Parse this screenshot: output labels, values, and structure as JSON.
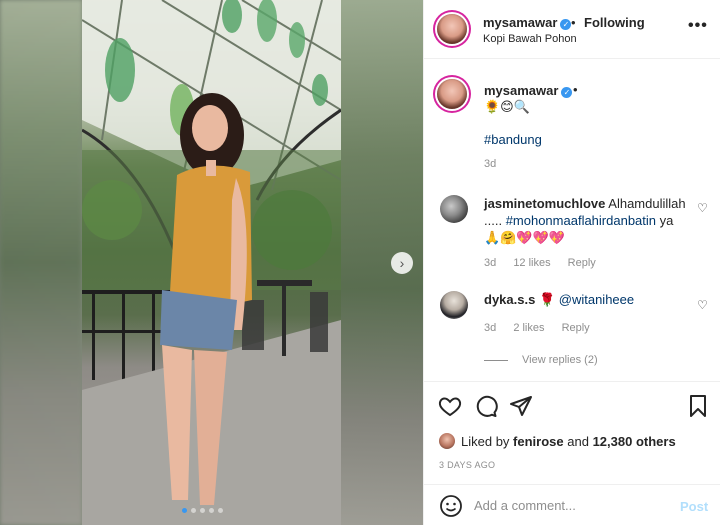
{
  "header": {
    "username": "mysamawar",
    "separator": "•",
    "follow_status": "Following",
    "location": "Kopi Bawah Pohon",
    "more_icon": "more-horizontal-icon",
    "more_label": "•••"
  },
  "caption": {
    "username": "mysamawar",
    "dot": "•",
    "emojis": "🌻😊🔍",
    "hashtag": "#bandung",
    "time": "3d"
  },
  "comments": [
    {
      "username": "jasminetomuchlove",
      "text_before": "Alhamdulillah .....",
      "tag": "#mohonmaaflahirdanbatin",
      "text_after": "ya",
      "emojis": "🙏🤗💖💖💖",
      "time": "3d",
      "likes": "12 likes",
      "reply": "Reply"
    },
    {
      "username": "dyka.s.s",
      "emoji": "🌹",
      "mention": "@witaniheee",
      "time": "3d",
      "likes": "2 likes",
      "reply": "Reply"
    }
  ],
  "view_replies": "View replies (2)",
  "actions": {
    "like_icon": "heart-icon",
    "comment_icon": "comment-icon",
    "share_icon": "share-icon",
    "save_icon": "bookmark-icon"
  },
  "likes": {
    "prefix": "Liked by",
    "user": "fenirose",
    "middle": "and",
    "others": "12,380 others"
  },
  "post_date": "3 DAYS AGO",
  "add_comment": {
    "placeholder": "Add a comment...",
    "post_label": "Post"
  },
  "carousel": {
    "total": 5,
    "active": 1
  },
  "colors": {
    "accent": "#3897f0",
    "link": "#00376b",
    "muted": "#8e8e8e",
    "post_disabled": "#b2dffc"
  }
}
